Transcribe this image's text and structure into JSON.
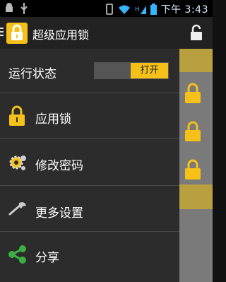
{
  "status_bar": {
    "time": "下午 3:43",
    "icons": [
      "android-debug-icon",
      "usb-icon",
      "vibrate-icon",
      "wifi-icon",
      "signal-icon",
      "battery-icon"
    ]
  },
  "app_bar": {
    "title": "超级应用锁",
    "menu_icon": "menu-icon",
    "logo_icon": "lock-icon",
    "action_icon": "unlock-icon"
  },
  "drawer": {
    "run_status": {
      "label": "运行状态",
      "toggle_label": "打开"
    },
    "items": [
      {
        "label": "应用锁",
        "icon": "lock-icon"
      },
      {
        "label": "修改密码",
        "icon": "gear-icon"
      },
      {
        "label": "更多设置",
        "icon": "wrench-icon"
      },
      {
        "label": "分享",
        "icon": "share-icon"
      }
    ]
  },
  "colors": {
    "accent": "#f5c017",
    "drawer_bg": "#2c2c2c",
    "share_green": "#3cb043"
  }
}
